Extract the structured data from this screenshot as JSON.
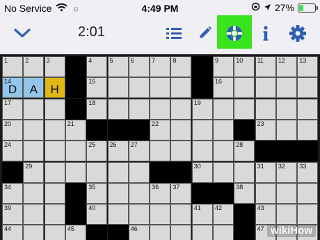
{
  "status_bar": {
    "carrier": "No Service",
    "time": "4:49 PM",
    "battery_percent": "27%",
    "battery_level": 0.27
  },
  "toolbar": {
    "timer": "2:01",
    "icons": [
      "chevron-down-icon",
      "list-icon",
      "pencil-icon",
      "lifebuoy-icon",
      "info-icon",
      "gear-icon"
    ],
    "accent_color": "#2f5fb3",
    "highlight_color": "#39e41f"
  },
  "grid": {
    "rows": [
      [
        {
          "n": "1"
        },
        {
          "n": "2"
        },
        {
          "n": "3"
        },
        {
          "b": 1
        },
        {
          "n": "4"
        },
        {
          "n": "5"
        },
        {
          "n": "6"
        },
        {
          "n": "7"
        },
        {
          "n": "8"
        },
        {
          "b": 1
        },
        {
          "n": "9"
        },
        {
          "n": "10"
        },
        {
          "n": "11"
        },
        {
          "n": "12"
        },
        {
          "n": "13"
        }
      ],
      [
        {
          "n": "14",
          "l": "D",
          "h": "blue"
        },
        {
          "l": "A",
          "h": "blue"
        },
        {
          "l": "H",
          "h": "yellow"
        },
        {
          "b": 1
        },
        {
          "n": "15"
        },
        {},
        {},
        {},
        {},
        {
          "b": 1
        },
        {
          "n": "16"
        },
        {},
        {},
        {},
        {}
      ],
      [
        {
          "n": "17"
        },
        {},
        {},
        {
          "b": 1
        },
        {
          "n": "18"
        },
        {},
        {},
        {},
        {},
        {
          "n": "19"
        },
        {},
        {},
        {},
        {},
        {}
      ],
      [
        {
          "n": "20"
        },
        {},
        {},
        {
          "n": "21"
        },
        {
          "b": 1
        },
        {
          "b": 1
        },
        {
          "b": 1
        },
        {
          "n": "22"
        },
        {},
        {},
        {},
        {
          "b": 1
        },
        {
          "n": "23"
        },
        {},
        {}
      ],
      [
        {
          "n": "24"
        },
        {},
        {},
        {},
        {
          "n": "25"
        },
        {
          "n": "26"
        },
        {
          "n": "27"
        },
        {},
        {},
        {},
        {},
        {
          "n": "28"
        },
        {
          "b": 1
        },
        {
          "b": 1
        },
        {
          "b": 1
        }
      ],
      [
        {
          "b": 1
        },
        {
          "n": "29"
        },
        {},
        {},
        {},
        {},
        {},
        {
          "b": 1
        },
        {
          "b": 1
        },
        {
          "n": "30"
        },
        {},
        {},
        {
          "n": "31"
        },
        {
          "n": "32"
        },
        {
          "n": "33"
        }
      ],
      [
        {
          "n": "34"
        },
        {},
        {},
        {
          "b": 1
        },
        {
          "n": "35"
        },
        {},
        {},
        {
          "n": "36"
        },
        {
          "n": "37"
        },
        {
          "b": 1
        },
        {
          "b": 1
        },
        {
          "n": "38"
        },
        {},
        {},
        {}
      ],
      [
        {
          "n": "39"
        },
        {},
        {},
        {
          "b": 1
        },
        {
          "n": "40"
        },
        {},
        {},
        {},
        {},
        {
          "n": "41"
        },
        {
          "n": "42"
        },
        {
          "b": 1
        },
        {
          "n": "43"
        },
        {},
        {}
      ],
      [
        {
          "n": "44"
        },
        {},
        {},
        {
          "n": "45"
        },
        {
          "b": 1
        },
        {
          "b": 1
        },
        {
          "n": "46"
        },
        {},
        {},
        {},
        {},
        {
          "b": 1
        },
        {
          "n": "47"
        },
        {},
        {}
      ]
    ]
  },
  "watermark": "wikiHow"
}
